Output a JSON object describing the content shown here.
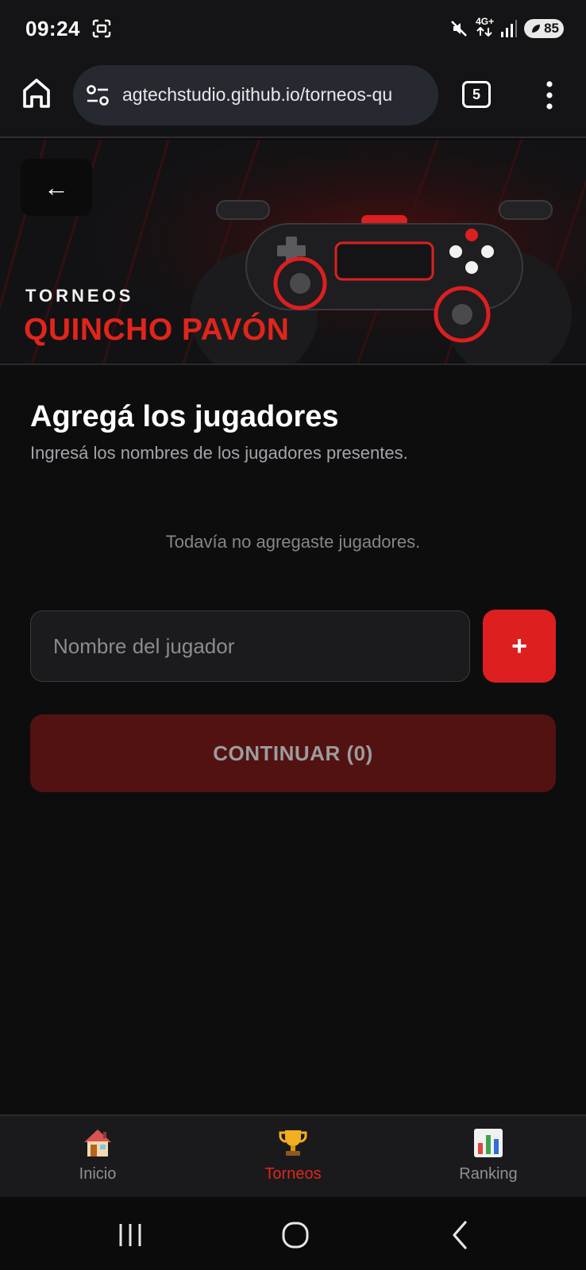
{
  "status_bar": {
    "time": "09:24",
    "network": "4G+",
    "battery": "85"
  },
  "browser": {
    "url": "agtechstudio.github.io/torneos-qu",
    "tab_count": "5"
  },
  "hero": {
    "back_label": "←",
    "kicker": "TORNEOS",
    "title": "QUINCHO PAVÓN"
  },
  "main": {
    "title": "Agregá los jugadores",
    "subtitle": "Ingresá los nombres de los jugadores presentes.",
    "empty_message": "Todavía no agregaste jugadores.",
    "input_placeholder": "Nombre del jugador",
    "add_label": "+",
    "continue_label": "CONTINUAR (0)"
  },
  "bottom_nav": {
    "items": [
      {
        "label": "Inicio",
        "icon": "house-icon",
        "active": false
      },
      {
        "label": "Torneos",
        "icon": "trophy-icon",
        "active": true
      },
      {
        "label": "Ranking",
        "icon": "bar-chart-icon",
        "active": false
      }
    ]
  },
  "colors": {
    "accent": "#e1251b",
    "background": "#0d0d0e",
    "disabled_button": "#531212"
  }
}
